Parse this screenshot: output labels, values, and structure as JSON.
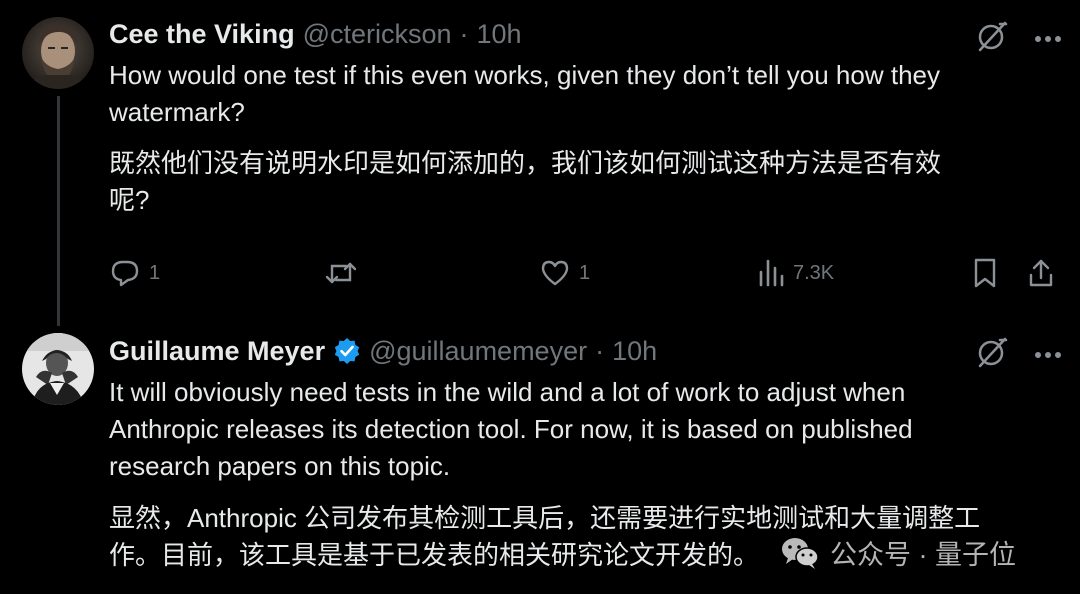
{
  "tweet1": {
    "name": "Cee the Viking",
    "handle": "@cterickson",
    "separator": "·",
    "time": "10h",
    "text_en": "How would one test if this even works, given they don’t tell you how they\nwatermark?",
    "text_zh": "既然他们没有说明水印是如何添加的，我们该如何测试这种方法是否有效\n呢?",
    "actions": {
      "replies": "1",
      "likes": "1",
      "views": "7.3K"
    }
  },
  "tweet2": {
    "name": "Guillaume Meyer",
    "handle": "@guillaumemeyer",
    "separator": "·",
    "time": "10h",
    "text_en": "It will obviously need tests in the wild and a lot of work to adjust when\nAnthropic releases its detection tool. For now, it is based on published\nresearch papers on this topic.",
    "text_zh": "显然，Anthropic 公司发布其检测工具后，还需要进行实地测试和大量调整工\n作。目前，该工具是基于已发表的相关研究论文开发的。"
  },
  "watermark": {
    "text": "公众号 · 量子位"
  },
  "colors": {
    "background": "#000000",
    "text_primary": "#e7e9ea",
    "text_secondary": "#71767b",
    "verified_blue": "#1d9bf0",
    "thread_line": "#333639"
  }
}
